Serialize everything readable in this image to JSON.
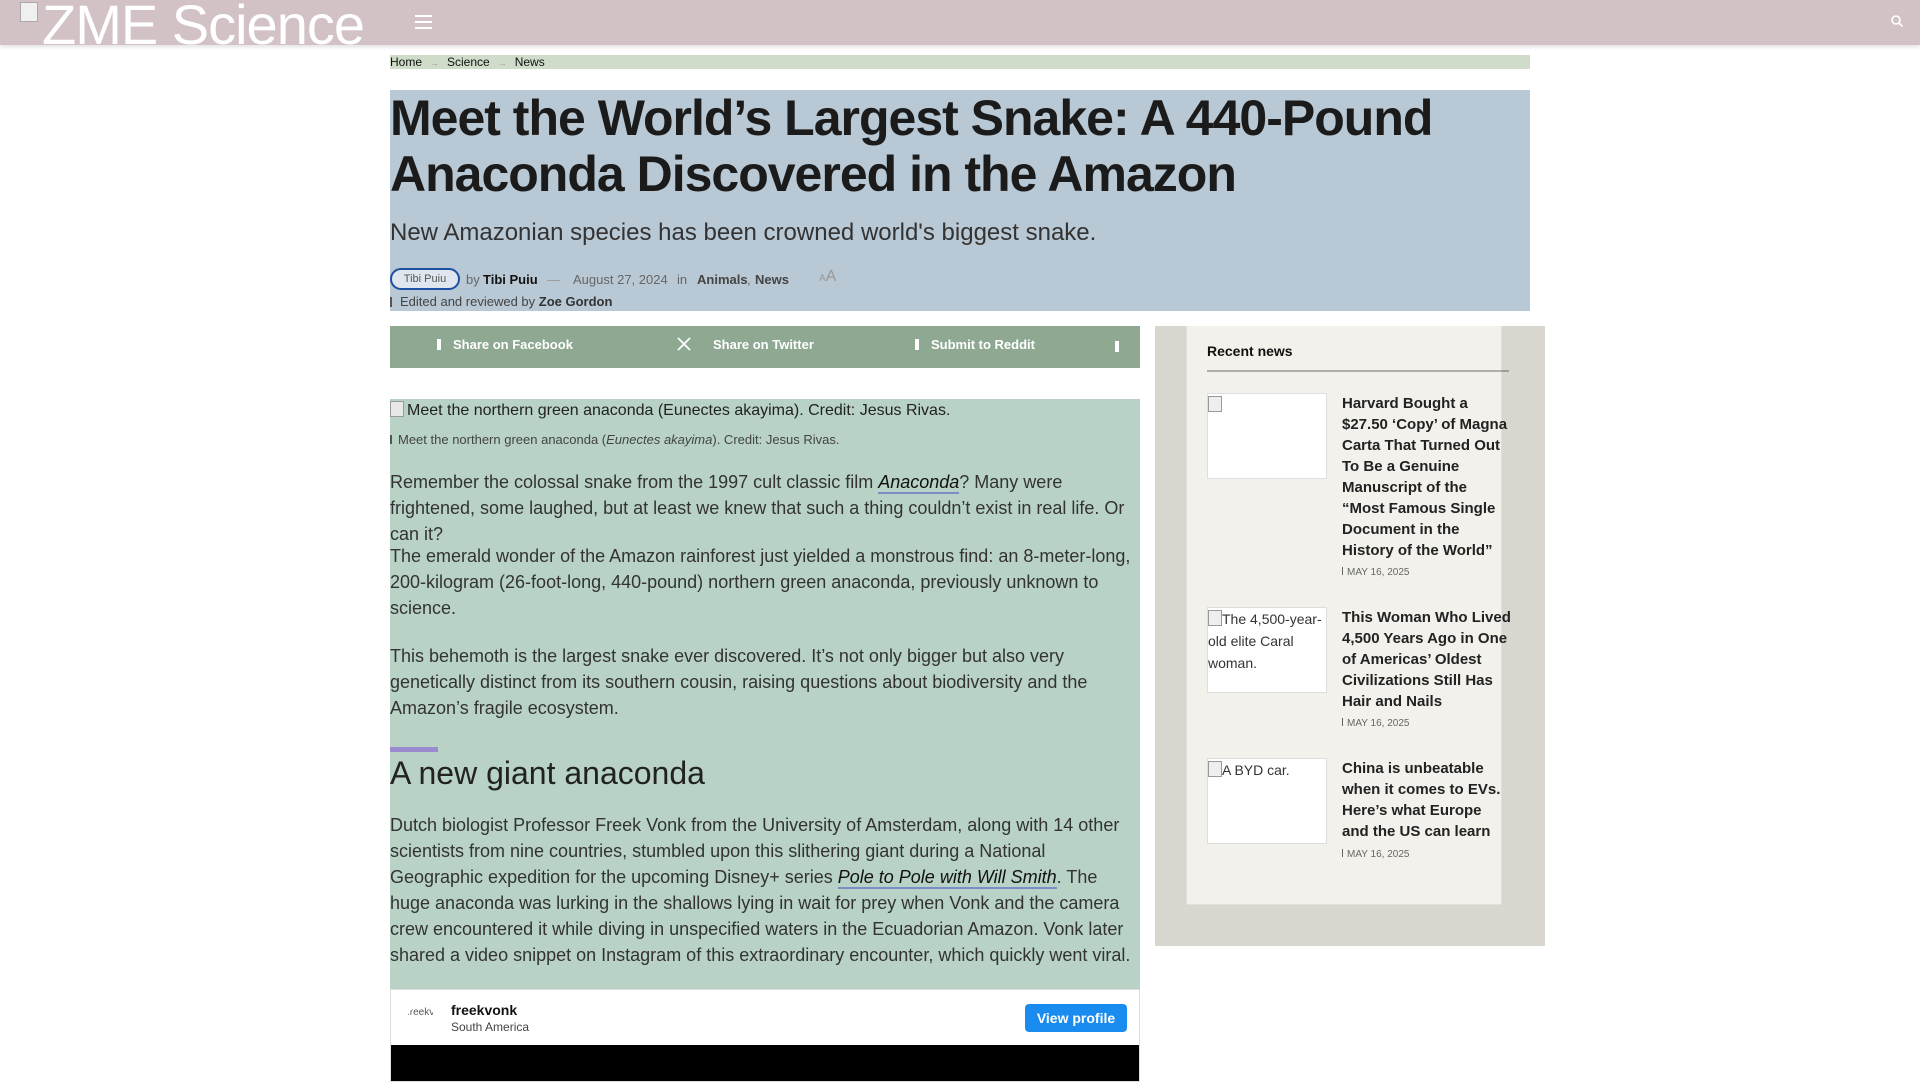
{
  "site": {
    "logo_text": "ZME Science"
  },
  "breadcrumb": [
    "Home",
    "Science",
    "News"
  ],
  "article": {
    "title": "Meet the World’s Largest Snake: A 440-Pound Anaconda Discovered in the Amazon",
    "subtitle": "New Amazonian species has been crowned world's biggest snake.",
    "avatar_alt": "Tibi Puiu",
    "by": "by",
    "author": "Tibi Puiu",
    "dash": "—",
    "date": "August 27, 2024",
    "in": "in",
    "categories": [
      "Animals",
      "News"
    ],
    "textsize_small": "A",
    "textsize_large": "A",
    "edited_prefix": "Edited and reviewed by",
    "editor": "Zoe Gordon",
    "image_alt": "Meet the northern green anaconda (Eunectes akayima). Credit: Jesus Rivas.",
    "caption_pre": "Meet the northern green anaconda (",
    "caption_italic": "Eunectes akayima",
    "caption_post": "). Credit: Jesus Rivas.",
    "p1_pre": "Remember the colossal snake from the 1997 cult classic film ",
    "p1_link": "Anaconda",
    "p1_post": "? Many were frightened, some laughed, but at least we knew that such a thing couldn’t exist in real life. Or can it?",
    "p2": "The emerald wonder of the Amazon rainforest just yielded a monstrous find: an 8-meter-long, 200-kilogram (26-foot-long, 440-pound) northern green anaconda, previously unknown to science.",
    "p3": "This behemoth is the largest snake ever discovered. It’s not only bigger but also very genetically distinct from its southern cousin, raising questions about biodiversity and the Amazon’s fragile ecosystem.",
    "h2": "A new giant anaconda",
    "p4_pre": "Dutch biologist Professor Freek Vonk from the University of Amsterdam, along with 14 other scientists from nine countries, stumbled upon this slithering giant during a National Geographic expedition for the upcoming Disney+ series ",
    "p4_link": "Pole to Pole with Will Smith",
    "p4_post": ". The huge anaconda was lurking in the shallows lying in wait for prey when Vonk and the camera crew encountered it while diving in unspecified waters in the Ecuadorian Amazon. Vonk later shared a video snippet on Instagram of this extraordinary encounter, which quickly went viral."
  },
  "share": {
    "facebook": "Share on Facebook",
    "twitter": "Share on Twitter",
    "reddit": "Submit to Reddit"
  },
  "embed": {
    "avatar_alt": "freekvonk",
    "username": "freekvonk",
    "location": "South America",
    "button": "View profile"
  },
  "sidebar": {
    "title": "Recent news",
    "items": [
      {
        "thumb_alt": "",
        "headline": "Harvard Bought a $27.50 ‘Copy’ of Magna Carta That Turned Out To Be a Genuine Manuscript of the “Most Famous Single Document in the History of the World”",
        "date": "MAY 16, 2025"
      },
      {
        "thumb_alt": "The 4,500-year-old elite Caral woman.",
        "headline": "This Woman Who Lived 4,500 Years Ago in One of Americas’ Oldest Civilizations Still Has Hair and Nails",
        "date": "MAY 16, 2025"
      },
      {
        "thumb_alt": "A BYD car.",
        "headline": "China is unbeatable when it comes to EVs. Here’s what Europe and the US can learn",
        "date": "MAY 16, 2025"
      }
    ]
  },
  "colors": {
    "topbar": "#d2c2c5",
    "breadcrumb_bg": "#cfdcc9",
    "header_bg": "#b8c8d4",
    "share_bg": "#8ea892",
    "content_bg": "#b8d2c6",
    "sidebar_bg": "#d8d6cf",
    "view_profile": "#1a8cf0"
  },
  "icons": [
    "menu-icon",
    "search-icon",
    "facebook-icon",
    "x-twitter-icon",
    "reddit-icon",
    "more-share-icon",
    "calendar-icon",
    "pencil-icon"
  ]
}
